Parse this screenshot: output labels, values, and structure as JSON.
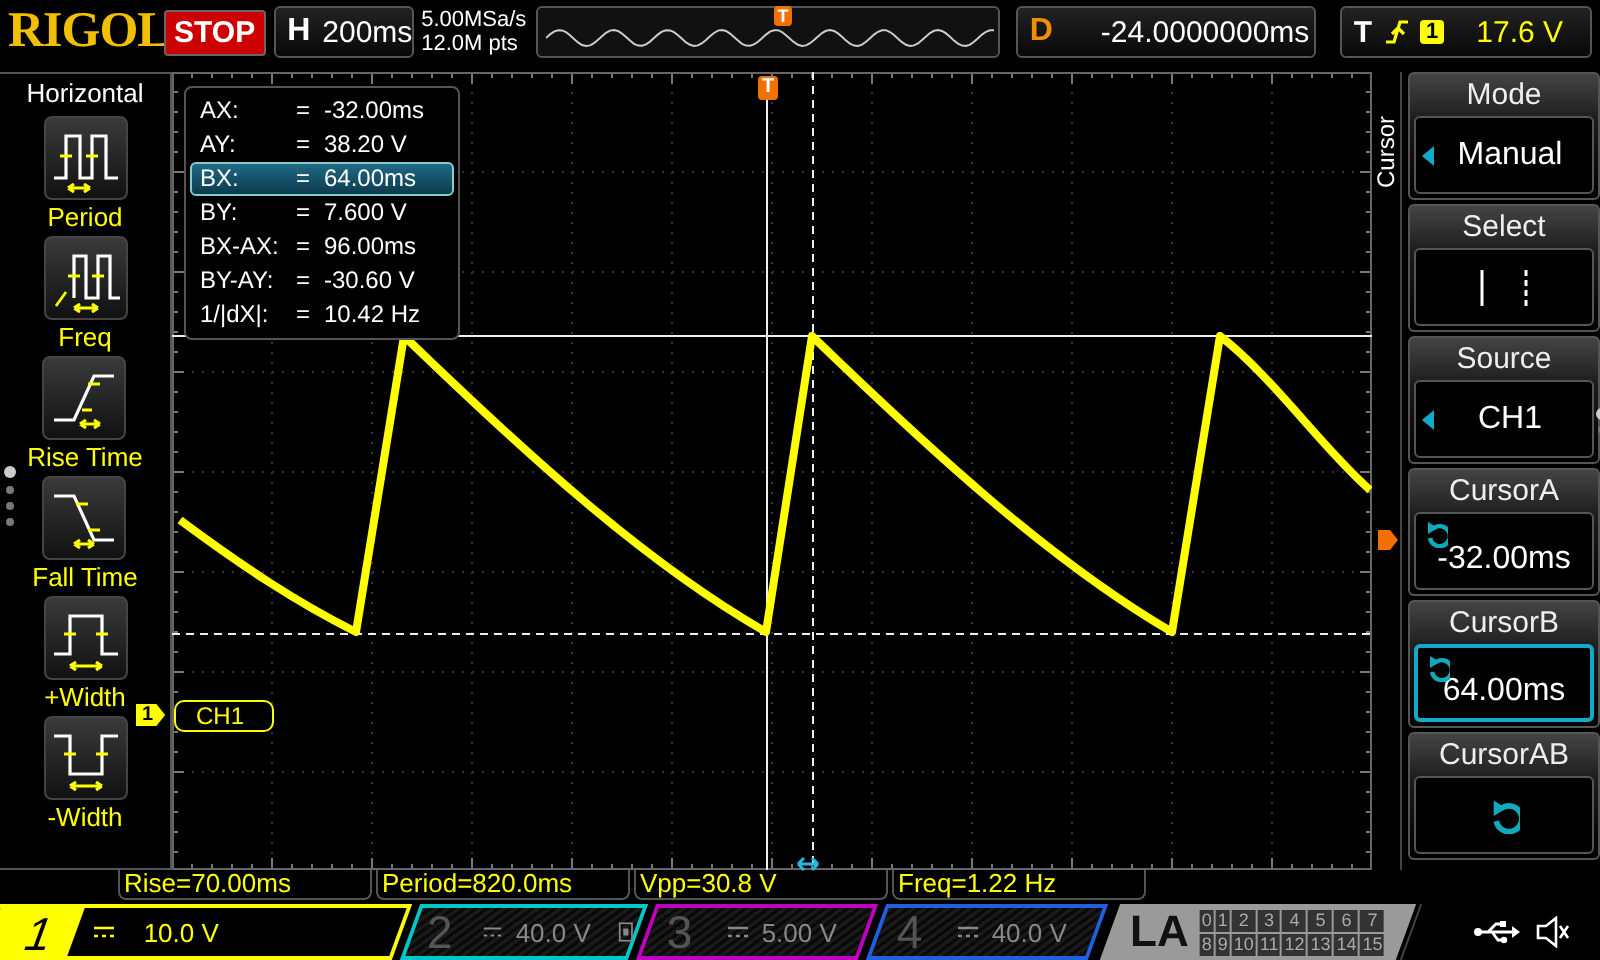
{
  "brand": "RIGOL",
  "run_state": "STOP",
  "timebase": {
    "label": "H",
    "value": "200ms"
  },
  "sampling": {
    "rate": "5.00MSa/s",
    "depth": "12.0M pts"
  },
  "overview_trigger": "T",
  "delay": {
    "label": "D",
    "value": "-24.0000000ms"
  },
  "trigger": {
    "label": "T",
    "source": "1",
    "level": "17.6 V"
  },
  "left_menu": {
    "title": "Horizontal",
    "items": [
      {
        "label": "Period",
        "kind": "period"
      },
      {
        "label": "Freq",
        "kind": "freq"
      },
      {
        "label": "Rise Time",
        "kind": "rise"
      },
      {
        "label": "Fall Time",
        "kind": "fall"
      },
      {
        "label": "+Width",
        "kind": "pwidth"
      },
      {
        "label": "-Width",
        "kind": "nwidth"
      }
    ]
  },
  "screen": {
    "trigger_marker": "T",
    "channel_marker": "1",
    "channel_label": "CH1",
    "cursor_readout": [
      {
        "name": "AX:",
        "sign": "=",
        "value": "-32.00ms",
        "selected": false
      },
      {
        "name": "AY:",
        "sign": "=",
        "value": "38.20 V",
        "selected": false
      },
      {
        "name": "BX:",
        "sign": "=",
        "value": "64.00ms",
        "selected": true
      },
      {
        "name": "BY:",
        "sign": "=",
        "value": "7.600 V",
        "selected": false
      },
      {
        "name": "BX-AX:",
        "sign": "=",
        "value": "96.00ms",
        "selected": false
      },
      {
        "name": "BY-AY:",
        "sign": "=",
        "value": "-30.60 V",
        "selected": false
      },
      {
        "name": "1/|dX|:",
        "sign": "=",
        "value": "10.42 Hz",
        "selected": false
      }
    ]
  },
  "menu_tab": "Cursor",
  "right_menu": [
    {
      "title": "Mode",
      "kind": "choice",
      "value": "Manual",
      "selected": false
    },
    {
      "title": "Select",
      "kind": "select",
      "selected": false
    },
    {
      "title": "Source",
      "kind": "choice",
      "value": "CH1",
      "selected": false
    },
    {
      "title": "CursorA",
      "kind": "knob",
      "value": "-32.00ms",
      "selected": false
    },
    {
      "title": "CursorB",
      "kind": "knob",
      "value": "64.00ms",
      "selected": true
    },
    {
      "title": "CursorAB",
      "kind": "knob",
      "selected": false
    }
  ],
  "measurements": [
    "Rise=70.00ms",
    "Period=820.0ms",
    "Vpp=30.8 V",
    "Freq=1.22 Hz"
  ],
  "channels": [
    {
      "number": "1",
      "scale": "10.0 V",
      "on": true,
      "color": "#ffff00"
    },
    {
      "number": "2",
      "scale": "40.0 V",
      "on": false,
      "color": "#00c8c8"
    },
    {
      "number": "3",
      "scale": "5.00 V",
      "on": false,
      "color": "#c000c0"
    },
    {
      "number": "4",
      "scale": "40.0 V",
      "on": false,
      "color": "#2060e0"
    }
  ],
  "la": {
    "label": "LA",
    "bits": [
      "0",
      "1",
      "2",
      "3",
      "4",
      "5",
      "6",
      "7",
      "8",
      "9",
      "10",
      "11",
      "12",
      "13",
      "14",
      "15"
    ]
  }
}
